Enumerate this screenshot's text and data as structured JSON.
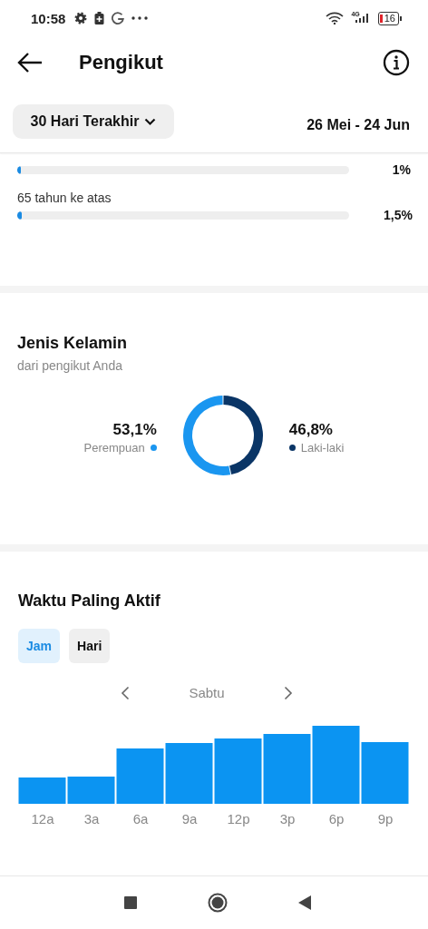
{
  "status_bar": {
    "time": "10:58",
    "network": "4G",
    "battery": "16"
  },
  "header": {
    "title": "Pengikut"
  },
  "filter": {
    "period": "30 Hari Terakhir",
    "date_range": "26 Mei - 24 Jun"
  },
  "age_rows": [
    {
      "level": 0.01,
      "percent": "1%"
    },
    {
      "label": "65 tahun ke atas",
      "level": 0.015,
      "percent": "1,5%"
    }
  ],
  "gender": {
    "title": "Jenis Kelamin",
    "subtitle": "dari pengikut Anda",
    "legend": [
      {
        "value": "53,1%",
        "label": "Perempuan",
        "color": "#1a96f0"
      },
      {
        "value": "46,8%",
        "label": "Laki-laki",
        "color": "#0a3566"
      }
    ],
    "chart_data": {
      "type": "donut",
      "values": [
        53.1,
        46.8
      ]
    }
  },
  "active_times": {
    "title": "Waktu Paling Aktif",
    "tabs": [
      {
        "label": "Jam",
        "selected": true
      },
      {
        "label": "Hari",
        "selected": false
      }
    ],
    "day": "Sabtu",
    "hour_labels": [
      "12a",
      "3a",
      "6a",
      "9a",
      "12p",
      "3p",
      "6p",
      "9p"
    ]
  }
}
